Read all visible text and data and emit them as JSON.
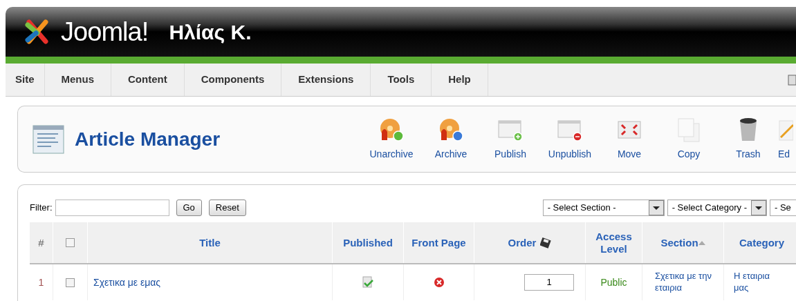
{
  "header": {
    "logo_text": "Joomla!",
    "site_name": "Ηλίας Κ."
  },
  "menu": {
    "items": [
      "Site",
      "Menus",
      "Content",
      "Components",
      "Extensions",
      "Tools",
      "Help"
    ]
  },
  "toolbar": {
    "title": "Article Manager",
    "buttons": [
      {
        "label": "Unarchive",
        "kind": "unarchive"
      },
      {
        "label": "Archive",
        "kind": "archive"
      },
      {
        "label": "Publish",
        "kind": "publish"
      },
      {
        "label": "Unpublish",
        "kind": "unpublish"
      },
      {
        "label": "Move",
        "kind": "move"
      },
      {
        "label": "Copy",
        "kind": "copy"
      },
      {
        "label": "Trash",
        "kind": "trash"
      },
      {
        "label": "Ed",
        "kind": "edit"
      }
    ]
  },
  "filter": {
    "label": "Filter:",
    "buttons": [
      "Go",
      "Reset"
    ],
    "selects": [
      "- Select Section -",
      "- Select Category -",
      "- Se"
    ]
  },
  "table": {
    "columns": [
      {
        "kind": "number",
        "label": "#"
      },
      {
        "kind": "checkbox",
        "checked": false
      },
      {
        "kind": "text",
        "label": "Title",
        "sorted": false
      },
      {
        "kind": "text",
        "label": "Published",
        "sorted": false
      },
      {
        "kind": "text",
        "label": "Front Page",
        "sorted": false
      },
      {
        "kind": "order",
        "label": "Order",
        "sorted": false
      },
      {
        "kind": "text",
        "label": "Access Level",
        "sorted": false
      },
      {
        "kind": "text",
        "label": "Section",
        "sorted": true
      },
      {
        "kind": "text",
        "label": "Category",
        "sorted": false
      }
    ],
    "rows": [
      {
        "number": "1",
        "checked": false,
        "title": "Σχετικα με εμας",
        "published": true,
        "front_page": false,
        "order": "1",
        "access": "Public",
        "section": "Σχετικα με την εταιρια",
        "category": "Η εταιρια μας"
      }
    ]
  }
}
